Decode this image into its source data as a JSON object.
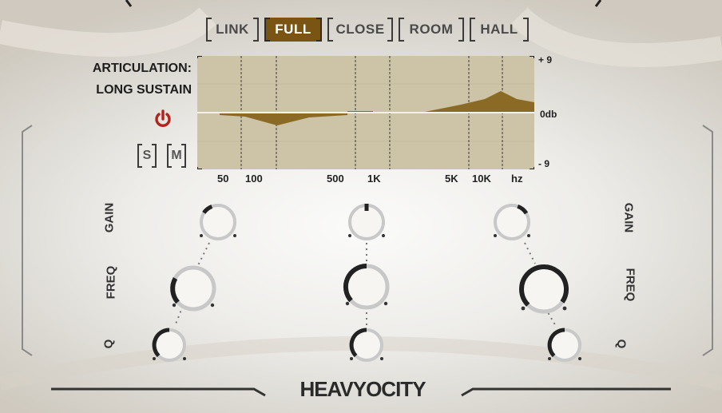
{
  "mic_positions": {
    "tabs": [
      {
        "label": "LINK",
        "active": false
      },
      {
        "label": "FULL",
        "active": true
      },
      {
        "label": "CLOSE",
        "active": false
      },
      {
        "label": "ROOM",
        "active": false
      },
      {
        "label": "HALL",
        "active": false
      }
    ]
  },
  "articulation": {
    "label": "ARTICULATION:",
    "value": "LONG SUSTAIN"
  },
  "controls": {
    "solo_label": "S",
    "mute_label": "M",
    "power_icon": "power-icon",
    "power_color": "#b3221b"
  },
  "eq_display": {
    "db_top": "+ 9",
    "db_mid": "0db",
    "db_bottom": "- 9",
    "freq_labels": [
      "50",
      "100",
      "500",
      "1K",
      "5K",
      "10K",
      "hz"
    ],
    "fill_color": "#8a6a25"
  },
  "bands": {
    "row_labels_left": [
      "GAIN",
      "FREQ",
      "Q"
    ],
    "row_labels_right": [
      "GAIN",
      "FREQ",
      "Q"
    ]
  },
  "brand": {
    "logo_text": "HEAVYOCITY"
  }
}
